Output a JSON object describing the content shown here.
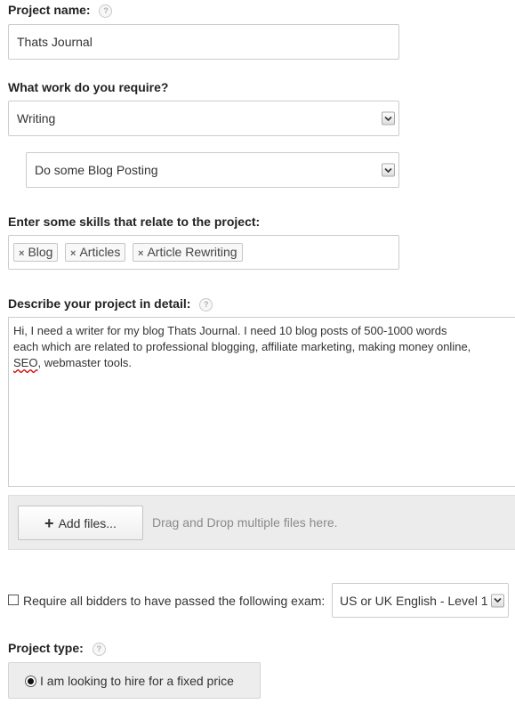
{
  "project_name": {
    "label": "Project name:",
    "help_icon": "?",
    "value": "Thats Journal"
  },
  "work": {
    "label": "What work do you require?",
    "category": "Writing",
    "subcategory": "Do some Blog Posting"
  },
  "skills": {
    "label": "Enter some skills that relate to the project:",
    "tags": [
      {
        "remove": "×",
        "label": "Blog"
      },
      {
        "remove": "×",
        "label": "Articles"
      },
      {
        "remove": "×",
        "label": "Article Rewriting"
      }
    ]
  },
  "description": {
    "label": "Describe your project in detail:",
    "help_icon": "?",
    "lines": [
      "Hi, I need a writer for my blog Thats Journal. I need 10 blog posts of 500-1000 words",
      "each which are related to professional blogging, affiliate marketing, making money online,",
      "webmaster tools."
    ],
    "misspelled_word": "SEO",
    "line3_separator": ", "
  },
  "files": {
    "button_icon": "+",
    "button_label": "Add files...",
    "hint": "Drag and Drop multiple files here."
  },
  "exam": {
    "label": "Require all bidders to have passed the following exam:",
    "checked": false,
    "selected": "US or UK English - Level 1"
  },
  "project_type": {
    "label": "Project type:",
    "help_icon": "?",
    "option_label": "I am looking to hire for a fixed price",
    "selected": true
  },
  "colors": {
    "border": "#cccccc",
    "dropzone_bg": "#ececec",
    "hint_text": "#8a8a8a",
    "spell_underline": "#d00000"
  }
}
